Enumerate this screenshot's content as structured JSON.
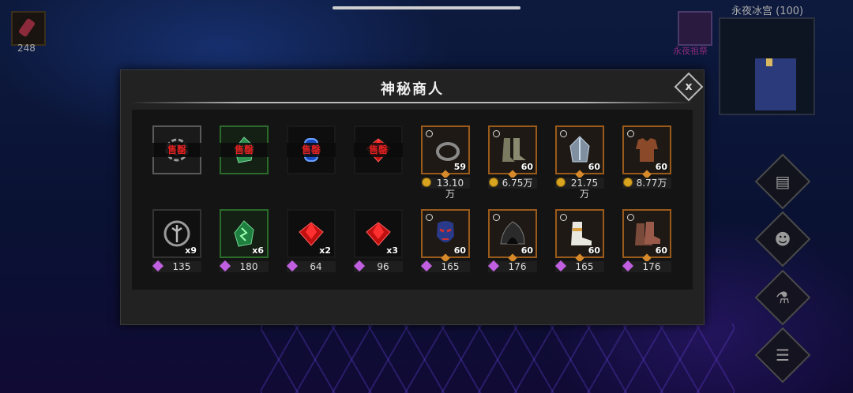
{
  "hud": {
    "left_count": "248",
    "right_label": "永夜祖祭",
    "zone": "永夜冰宫 (100)"
  },
  "dialog": {
    "title": "神秘商人",
    "close_icon": "x"
  },
  "colors": {
    "currency_gold": "#d9a520",
    "currency_gem": "#c060e0",
    "sold_text": "#e02020",
    "equipment_frame": "#9a5a1a"
  },
  "row1": [
    {
      "icon": "rune-ring-icon",
      "frame": "gray",
      "sold": "售罄"
    },
    {
      "icon": "green-crystal-icon",
      "frame": "green",
      "sold": "售罄"
    },
    {
      "icon": "blue-gem-icon",
      "frame": "blue",
      "sold": "售罄"
    },
    {
      "icon": "red-gem-icon",
      "frame": "red",
      "sold": "售罄"
    },
    {
      "icon": "ring-icon",
      "frame": "orange",
      "level": "59",
      "price": "13.10万",
      "currency": "gold"
    },
    {
      "icon": "greaves-icon",
      "frame": "orange",
      "level": "60",
      "price": "6.75万",
      "currency": "gold"
    },
    {
      "icon": "helmet-icon",
      "frame": "orange",
      "level": "60",
      "price": "21.75万",
      "currency": "gold"
    },
    {
      "icon": "leather-armor-icon",
      "frame": "orange",
      "level": "60",
      "price": "8.77万",
      "currency": "gold"
    }
  ],
  "row2": [
    {
      "icon": "rune-stone-icon",
      "frame": "dark",
      "qty": "x9",
      "price": "135",
      "currency": "gem"
    },
    {
      "icon": "green-rune-crystal-icon",
      "frame": "green",
      "qty": "x6",
      "price": "180",
      "currency": "gem"
    },
    {
      "icon": "red-gem-icon",
      "frame": "red",
      "qty": "x2",
      "price": "64",
      "currency": "gem"
    },
    {
      "icon": "red-gem-icon",
      "frame": "red",
      "qty": "x3",
      "price": "96",
      "currency": "gem"
    },
    {
      "icon": "mask-icon",
      "frame": "orange",
      "level": "60",
      "price": "165",
      "currency": "gem"
    },
    {
      "icon": "hood-icon",
      "frame": "orange",
      "level": "60",
      "price": "176",
      "currency": "gem"
    },
    {
      "icon": "boots-icon",
      "frame": "orange",
      "level": "60",
      "price": "165",
      "currency": "gem"
    },
    {
      "icon": "leather-boots-icon",
      "frame": "orange",
      "level": "60",
      "price": "176",
      "currency": "gem"
    }
  ]
}
